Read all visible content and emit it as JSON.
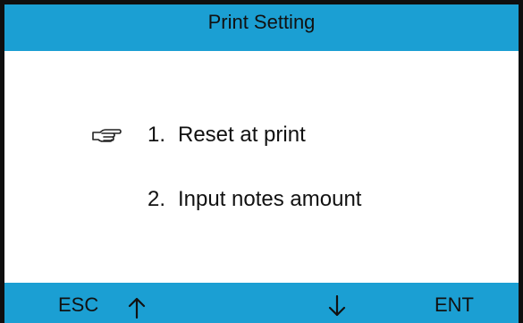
{
  "header": {
    "title": "Print Setting"
  },
  "menu": {
    "selected_index": 0,
    "items": [
      {
        "number": "1.",
        "label": "Reset at print"
      },
      {
        "number": "2.",
        "label": "Input notes amount"
      }
    ]
  },
  "footer": {
    "esc_label": "ESC",
    "ent_label": "ENT",
    "up_icon": "up-arrow-icon",
    "down_icon": "down-arrow-icon"
  },
  "colors": {
    "bar": "#1b9fd3",
    "frame": "#0f0f0f",
    "background": "#ffffff"
  }
}
